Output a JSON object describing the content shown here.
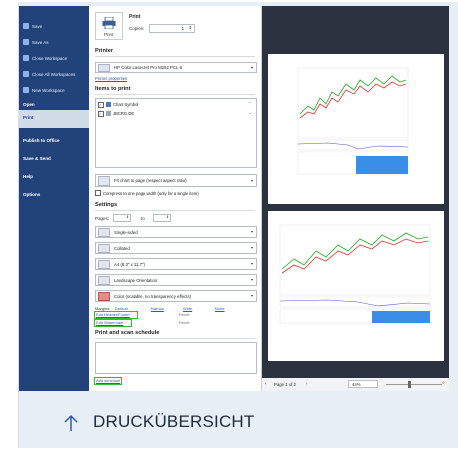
{
  "nav": {
    "items": [
      {
        "label": "Save"
      },
      {
        "label": "Save As"
      },
      {
        "label": "Close Workspace"
      },
      {
        "label": "Close All Workspaces"
      },
      {
        "label": "New Workspace"
      }
    ],
    "sections": [
      {
        "label": "Open"
      },
      {
        "label": "Print"
      },
      {
        "label": "Publish to Office"
      },
      {
        "label": "Save & Send"
      },
      {
        "label": "Help"
      },
      {
        "label": "Options"
      }
    ]
  },
  "print": {
    "title": "Print",
    "button_label": "Print",
    "copies_label": "Copies:",
    "copies_value": "1",
    "printer_heading": "Printer",
    "printer_name": "HP Color LaserJet Pro M252 PCL-6",
    "printer_properties": "Printer properties",
    "items_heading": "Items to print",
    "items": [
      {
        "label": "Chart Symbol"
      },
      {
        "label": "JBCRG.DE"
      }
    ],
    "fit_option": "Fit chart to page (respect aspect ratio)",
    "compress_option": "Compress to one page width (only for a single item)",
    "settings_heading": "Settings",
    "pages_label": "Pages:",
    "to_label": "to",
    "settings": [
      {
        "label": "Single-sided"
      },
      {
        "label": "Collated"
      },
      {
        "label": "A4 (8.3\" x 11.7\")"
      },
      {
        "label": "Landscape Orientation"
      },
      {
        "label": "Color (scalable, no transparency effects)"
      }
    ],
    "margins_label": "Margins:",
    "margins_options": [
      "Default",
      "Narrow",
      "Wide",
      "None"
    ],
    "edit_header": "Edit Header/Footer",
    "edit_watermark": "Edit Watermark",
    "reset_1": "Reset",
    "reset_2": "Reset",
    "schedule_heading": "Print and scan schedule",
    "add_schedule": "Add schedule"
  },
  "status": {
    "page_text": "Page 1 of 2",
    "zoom": "44%"
  },
  "footer": {
    "title": "DRUCKÜBERSICHT"
  }
}
